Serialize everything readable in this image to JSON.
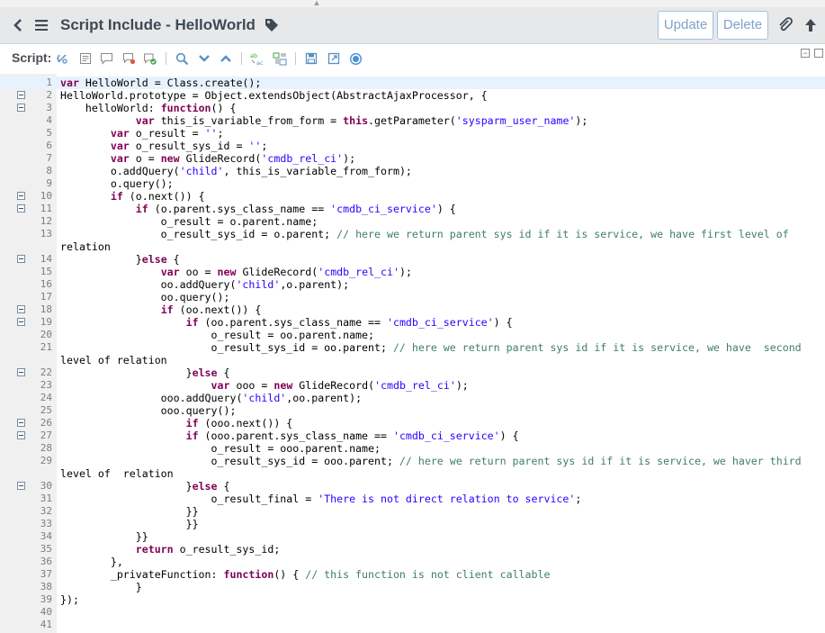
{
  "header": {
    "title": "Script Include - HelloWorld",
    "update_label": "Update",
    "delete_label": "Delete"
  },
  "toolbar": {
    "script_label": "Script:",
    "icons": [
      "toggle-syntax-icon",
      "comment-icon",
      "speech-bubble-icon",
      "remove-comment-icon",
      "check-syntax-icon",
      "search-icon",
      "chevron-down-icon",
      "chevron-up-icon",
      "replace-icon",
      "replace-all-icon",
      "save-icon",
      "fullscreen-icon",
      "help-icon"
    ]
  },
  "colors": {
    "keyword": "#7f0055",
    "string": "#2a00ff",
    "comment": "#3f7f5f",
    "button_border": "#9fc3e6",
    "header_bg": "#e6e8ea"
  },
  "editor": {
    "lines": [
      {
        "num": "1",
        "fold": false,
        "text": "var HelloWorld = Class.create();"
      },
      {
        "num": "2",
        "fold": true,
        "text": "HelloWorld.prototype = Object.extendsObject(AbstractAjaxProcessor, {"
      },
      {
        "num": "3",
        "fold": true,
        "text": "    helloWorld: function() {"
      },
      {
        "num": "4",
        "fold": false,
        "text": "            var this_is_variable_from_form = this.getParameter('sysparm_user_name');"
      },
      {
        "num": "5",
        "fold": false,
        "text": "        var o_result = '';"
      },
      {
        "num": "6",
        "fold": false,
        "text": "        var o_result_sys_id = '';"
      },
      {
        "num": "7",
        "fold": false,
        "text": "        var o = new GlideRecord('cmdb_rel_ci');"
      },
      {
        "num": "8",
        "fold": false,
        "text": "        o.addQuery('child', this_is_variable_from_form);"
      },
      {
        "num": "9",
        "fold": false,
        "text": "        o.query();"
      },
      {
        "num": "10",
        "fold": true,
        "text": "        if (o.next()) {"
      },
      {
        "num": "11",
        "fold": true,
        "text": "            if (o.parent.sys_class_name == 'cmdb_ci_service') {"
      },
      {
        "num": "12",
        "fold": false,
        "text": "                o_result = o.parent.name;"
      },
      {
        "num": "13",
        "fold": false,
        "text": "                o_result_sys_id = o.parent; // here we return parent sys id if it is service, we have first level of"
      },
      {
        "num": "",
        "fold": false,
        "text": "relation"
      },
      {
        "num": "14",
        "fold": true,
        "text": "            }else {"
      },
      {
        "num": "15",
        "fold": false,
        "text": "                var oo = new GlideRecord('cmdb_rel_ci');"
      },
      {
        "num": "16",
        "fold": false,
        "text": "                oo.addQuery('child',o.parent);"
      },
      {
        "num": "17",
        "fold": false,
        "text": "                oo.query();"
      },
      {
        "num": "18",
        "fold": true,
        "text": "                if (oo.next()) {"
      },
      {
        "num": "19",
        "fold": true,
        "text": "                    if (oo.parent.sys_class_name == 'cmdb_ci_service') {"
      },
      {
        "num": "20",
        "fold": false,
        "text": "                        o_result = oo.parent.name;"
      },
      {
        "num": "21",
        "fold": false,
        "text": "                        o_result_sys_id = oo.parent; // here we return parent sys id if it is service, we have  second"
      },
      {
        "num": "",
        "fold": false,
        "text": "level of relation"
      },
      {
        "num": "22",
        "fold": true,
        "text": "                    }else {"
      },
      {
        "num": "23",
        "fold": false,
        "text": "                        var ooo = new GlideRecord('cmdb_rel_ci');"
      },
      {
        "num": "24",
        "fold": false,
        "text": "                ooo.addQuery('child',oo.parent);"
      },
      {
        "num": "25",
        "fold": false,
        "text": "                ooo.query();"
      },
      {
        "num": "26",
        "fold": true,
        "text": "                    if (ooo.next()) {"
      },
      {
        "num": "27",
        "fold": true,
        "text": "                    if (ooo.parent.sys_class_name == 'cmdb_ci_service') {"
      },
      {
        "num": "28",
        "fold": false,
        "text": "                        o_result = ooo.parent.name;"
      },
      {
        "num": "29",
        "fold": false,
        "text": "                        o_result_sys_id = ooo.parent; // here we return parent sys id if it is service, we haver third"
      },
      {
        "num": "",
        "fold": false,
        "text": "level of  relation"
      },
      {
        "num": "30",
        "fold": true,
        "text": "                    }else {"
      },
      {
        "num": "31",
        "fold": false,
        "text": "                        o_result_final = 'There is not direct relation to service';"
      },
      {
        "num": "32",
        "fold": false,
        "text": "                    }}"
      },
      {
        "num": "33",
        "fold": false,
        "text": "                    }}"
      },
      {
        "num": "34",
        "fold": false,
        "text": "            }}"
      },
      {
        "num": "35",
        "fold": false,
        "text": "            return o_result_sys_id;"
      },
      {
        "num": "36",
        "fold": false,
        "text": "        },"
      },
      {
        "num": "37",
        "fold": false,
        "text": "        _privateFunction: function() { // this function is not client callable"
      },
      {
        "num": "38",
        "fold": false,
        "text": "            }"
      },
      {
        "num": "39",
        "fold": false,
        "text": "});"
      },
      {
        "num": "40",
        "fold": false,
        "text": ""
      },
      {
        "num": "41",
        "fold": false,
        "text": ""
      }
    ]
  }
}
